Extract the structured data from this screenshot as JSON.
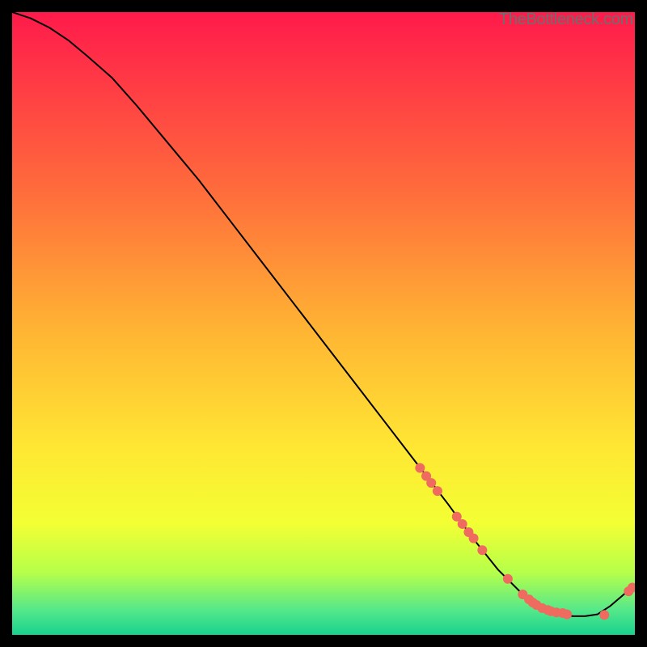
{
  "watermark": "TheBottleneck.com",
  "chart_data": {
    "type": "line",
    "title": "",
    "xlabel": "",
    "ylabel": "",
    "xlim": [
      0,
      100
    ],
    "ylim": [
      0,
      100
    ],
    "grid": false,
    "curve": {
      "name": "bottleneck-curve",
      "x": [
        0,
        3,
        6,
        9,
        12,
        16,
        20,
        25,
        30,
        35,
        40,
        45,
        50,
        55,
        60,
        65,
        70,
        74,
        76,
        78,
        80,
        82,
        84,
        86,
        88,
        90,
        92,
        94,
        96,
        98,
        100
      ],
      "y": [
        100,
        99,
        97.5,
        95.5,
        93,
        89.5,
        85,
        79,
        73,
        66.5,
        60,
        53.5,
        47,
        40.5,
        34,
        27.5,
        21,
        15.5,
        13,
        10.5,
        8.5,
        6.5,
        5,
        4,
        3.4,
        3,
        3,
        3.3,
        4.6,
        6.3,
        8
      ]
    },
    "points": {
      "name": "markers",
      "color": "#ef6b60",
      "radius": 6,
      "x": [
        65.5,
        66.5,
        67.3,
        68.3,
        71.4,
        72.3,
        73.3,
        74.1,
        75.5,
        79.6,
        82.0,
        83.0,
        83.6,
        84.2,
        85.1,
        86.0,
        86.5,
        87.4,
        88.4,
        89.1,
        95.1,
        99.0,
        99.6
      ],
      "y": [
        26.8,
        25.5,
        24.4,
        23.1,
        19.0,
        17.8,
        16.5,
        15.5,
        13.6,
        9.0,
        6.5,
        5.7,
        5.2,
        4.8,
        4.3,
        4.0,
        3.8,
        3.6,
        3.5,
        3.3,
        3.2,
        7.0,
        7.6
      ]
    },
    "colors": {
      "line": "#000000",
      "point": "#ef6b60",
      "gradient_top": "#ff1a4b",
      "gradient_mid_upper": "#ff7b3a",
      "gradient_mid": "#ffd633",
      "gradient_mid_lower": "#f7ff33",
      "gradient_low": "#9fff5a",
      "gradient_bottom": "#1fe08a"
    }
  }
}
